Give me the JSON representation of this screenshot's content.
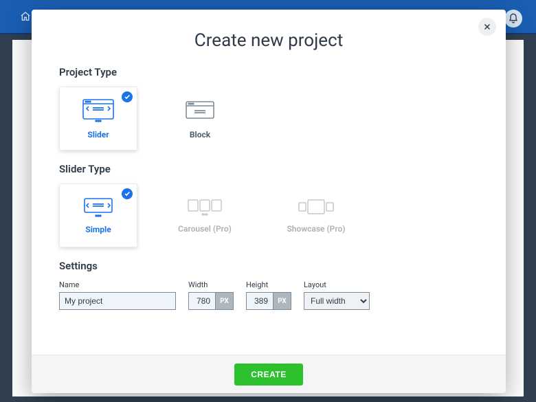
{
  "modal": {
    "title": "Create new project",
    "section_project_type": "Project Type",
    "section_slider_type": "Slider Type",
    "section_settings": "Settings"
  },
  "project_types": {
    "slider": "Slider",
    "block": "Block"
  },
  "slider_types": {
    "simple": "Simple",
    "carousel": "Carousel (Pro)",
    "showcase": "Showcase (Pro)"
  },
  "settings": {
    "name_label": "Name",
    "name_value": "My project",
    "width_label": "Width",
    "width_value": "780",
    "width_unit": "PX",
    "height_label": "Height",
    "height_value": "389",
    "height_unit": "PX",
    "layout_label": "Layout",
    "layout_value": "Full width"
  },
  "footer": {
    "create": "CREATE"
  },
  "colors": {
    "accent": "#1a73e8",
    "success": "#2ec12e"
  }
}
